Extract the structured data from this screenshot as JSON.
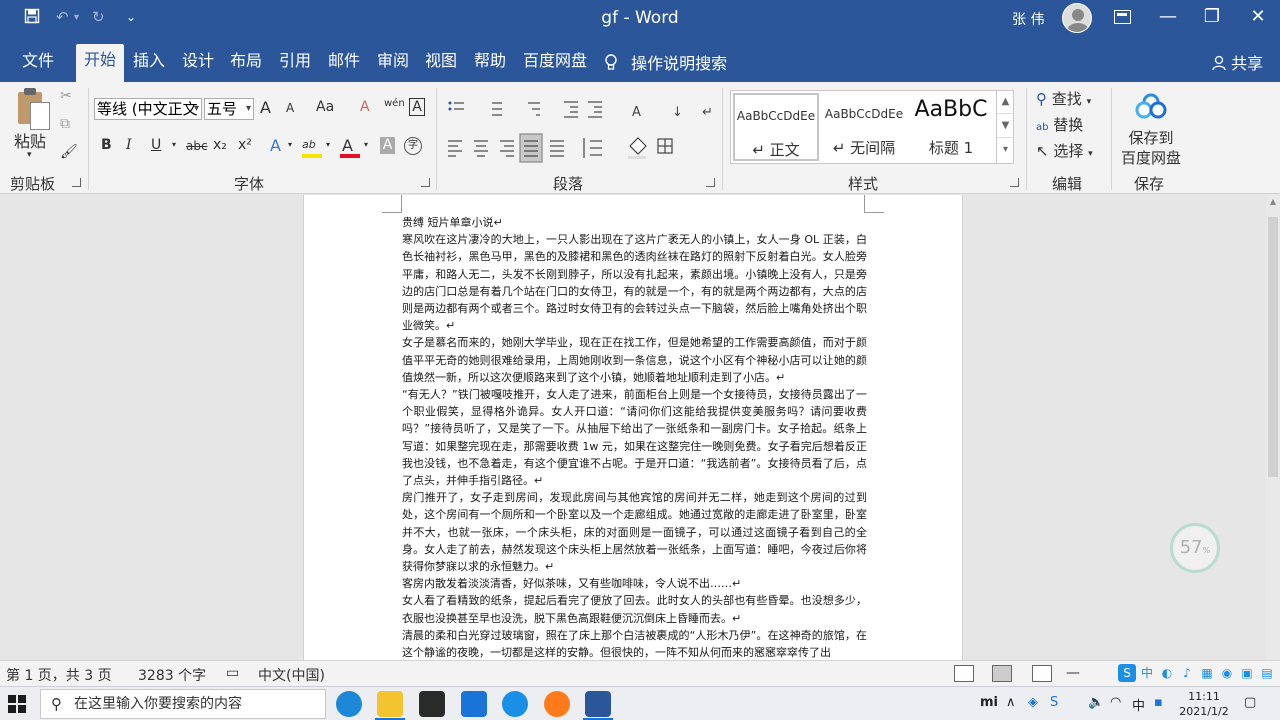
{
  "titlebar": {
    "save_icon": "save-icon",
    "undo_icon": "undo-icon",
    "redo_icon": "redo-icon",
    "qa_dropdown": "⌄",
    "title": "gf  -  Word",
    "user": "张 伟",
    "minimize": "—",
    "restore": "❐",
    "close": "✕"
  },
  "tabs": [
    {
      "label": "文件"
    },
    {
      "label": "开始"
    },
    {
      "label": "插入"
    },
    {
      "label": "设计"
    },
    {
      "label": "布局"
    },
    {
      "label": "引用"
    },
    {
      "label": "邮件"
    },
    {
      "label": "审阅"
    },
    {
      "label": "视图"
    },
    {
      "label": "帮助"
    },
    {
      "label": "百度网盘"
    }
  ],
  "tell_me": "操作说明搜索",
  "share": "共享",
  "ribbon": {
    "clipboard": {
      "paste": "粘贴",
      "label": "剪贴板"
    },
    "font": {
      "name": "等线 (中文正文",
      "size": "五号",
      "label": "字体",
      "grow": "A",
      "shrink": "A",
      "case": "Aa",
      "clear": "A",
      "phonetic": "wén",
      "border": "A",
      "bold": "B",
      "italic": "I",
      "underline": "U",
      "strike": "abc",
      "sub": "x₂",
      "sup": "x²",
      "effects": "A",
      "highlight": "ab",
      "color": "A",
      "shade": "A",
      "enclose": "字",
      "highlight_color": "#f6e400",
      "font_color": "#e81123"
    },
    "paragraph": {
      "label": "段落"
    },
    "styles": {
      "label": "样式",
      "items": [
        {
          "sample": "AaBbCcDdEe",
          "name": "↵ 正文"
        },
        {
          "sample": "AaBbCcDdEe",
          "name": "↵ 无间隔"
        },
        {
          "sample": "AaBbC",
          "name": "标题 1"
        }
      ]
    },
    "editing": {
      "label": "编辑",
      "find": "查找",
      "replace": "替换",
      "select": "选择"
    },
    "save": {
      "label": "保存",
      "button_line1": "保存到",
      "button_line2": "百度网盘"
    }
  },
  "document": {
    "paragraphs": [
      "贵缚  短片单章小说↵",
      "寒风吹在这片凄冷的大地上，一只人影出现在了这片广袤无人的小镇上，女人一身 OL 正装，白色长袖衬衫，黑色马甲，黑色的及膝裙和黑色的透肉丝袜在路灯的照射下反射着白光。女人脸旁平庸，和路人无二，头发不长刚到脖子，所以没有扎起来，素颜出境。小镇晚上没有人，只是旁边的店门口总是有着几个站在门口的女侍卫，有的就是一个，有的就是两个两边都有，大点的店则是两边都有两个或者三个。路过时女侍卫有的会转过头点一下脑袋，然后脸上嘴角处挤出个职业微笑。↵",
      "女子是慕名而来的，她刚大学毕业，现在正在找工作，但是她希望的工作需要高颜值，而对于颜值平平无奇的她则很难给录用，上周她刚收到一条信息，说这个小区有个神秘小店可以让她的颜值焕然一新，所以这次便顺路来到了这个小镇，她顺着地址顺利走到了小店。↵",
      "“有无人？”铁门被嘎吱推开，女人走了进来，前面柜台上则是一个女接待员，女接待员露出了一个职业假笑，显得格外诡异。女人开口道：“请问你们这能给我提供变美服务吗？请问要收费吗？”接待员听了，又是笑了一下。从抽屉下给出了一张纸条和一副房门卡。女子拾起。纸条上写道：如果整完现在走，那需要收费 1w 元，如果在这整完住一晚则免费。女子看完后想着反正我也没钱，也不急着走，有这个便宜谁不占呢。于是开口道：“我选前者”。女接待员看了后，点了点头，并伸手指引路径。↵",
      "房门推开了，女子走到房间，发现此房间与其他宾馆的房间并无二样，她走到这个房间的过到处，这个房间有一个厕所和一个卧室以及一个走廊组成。她通过宽敞的走廊走进了卧室里，卧室并不大，也就一张床，一个床头柜，床的对面则是一面镜子，可以通过这面镜子看到自己的全身。女人走了前去，赫然发现这个床头柜上居然放着一张纸条，上面写道：睡吧，今夜过后你将获得你梦寐以求的永恒魅力。↵",
      "客房内散发着淡淡清香，好似茶味，又有些咖啡味，令人说不出……↵",
      "女人看了看精致的纸条，提起后看完了便放了回去。此时女人的头部也有些昏晕。也没想多少，衣服也没换甚至早也没洗，脱下黑色高跟鞋便沉沉倒床上昏睡而去。↵",
      "清晨的柔和白光穿过玻璃窗，照在了床上那个白洁被裹成的“人形木乃伊”。在这神奇的旅馆，在这个静谧的夜晚，一切都是这样的安静。但很快的，一阵不知从何而来的窸窸窣窣传了出"
    ],
    "gauge": "57",
    "gauge_unit": "%"
  },
  "status": {
    "page": "第 1 页，共 3 页",
    "words": "3283 个字",
    "lang": "中文(中国)",
    "zoom_minus": "—"
  },
  "taskbar": {
    "search_placeholder": "在这里输入你要搜索的内容",
    "time": "11:11",
    "date": "2021/1/2"
  }
}
